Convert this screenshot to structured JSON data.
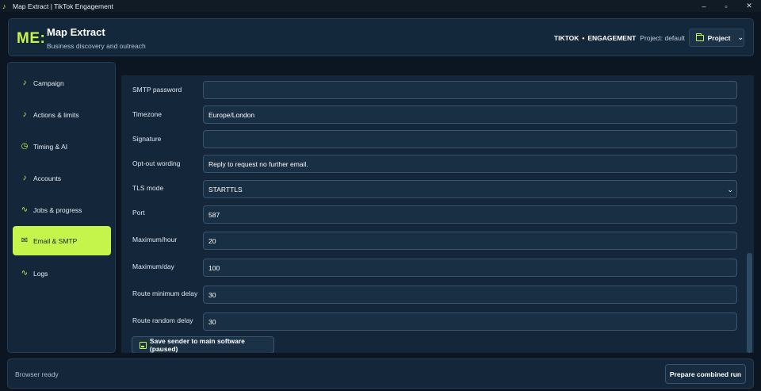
{
  "window": {
    "title": "Map Extract | TikTok Engagement",
    "controls": {
      "minimize": "–",
      "maximize": "▫",
      "close": "✕"
    }
  },
  "header": {
    "logo": "ME:",
    "app_name": "Map Extract",
    "subtitle": "Business discovery and outreach",
    "platform": "TIKTOK",
    "separator": "•",
    "mode": "ENGAGEMENT",
    "project_text": "Project: default",
    "project_button": "Project"
  },
  "sidebar": {
    "items": [
      {
        "label": "Campaign",
        "icon": "tiktok-icon",
        "glyph": "♪"
      },
      {
        "label": "Actions & limits",
        "icon": "tiktok-icon",
        "glyph": "♪"
      },
      {
        "label": "Timing & AI",
        "icon": "clock-icon",
        "glyph": "◷"
      },
      {
        "label": "Accounts",
        "icon": "tiktok-icon",
        "glyph": "♪"
      },
      {
        "label": "Jobs & progress",
        "icon": "activity-icon",
        "glyph": "∿"
      },
      {
        "label": "Email & SMTP",
        "icon": "mail-icon",
        "glyph": "✉"
      },
      {
        "label": "Logs",
        "icon": "activity-icon",
        "glyph": "∿"
      }
    ],
    "active_index": 5
  },
  "form": {
    "fields": [
      {
        "label": "SMTP password",
        "value": ""
      },
      {
        "label": "Timezone",
        "value": "Europe/London"
      },
      {
        "label": "Signature",
        "value": ""
      },
      {
        "label": "Opt-out wording",
        "value": "Reply to request no further email."
      },
      {
        "label": "TLS mode",
        "value": "STARTTLS",
        "type": "select"
      },
      {
        "label": "Port",
        "value": "587"
      },
      {
        "label": "Maximum/hour",
        "value": "20"
      },
      {
        "label": "Maximum/day",
        "value": "100"
      },
      {
        "label": "Route minimum delay",
        "value": "30"
      },
      {
        "label": "Route random delay",
        "value": "30"
      }
    ],
    "save_button": "Save sender to main software (paused)"
  },
  "footer": {
    "status": "Browser ready",
    "run_button": "Prepare combined run"
  },
  "colors": {
    "accent": "#c5f54b",
    "background": "#0b1622",
    "panel": "#13263a"
  }
}
